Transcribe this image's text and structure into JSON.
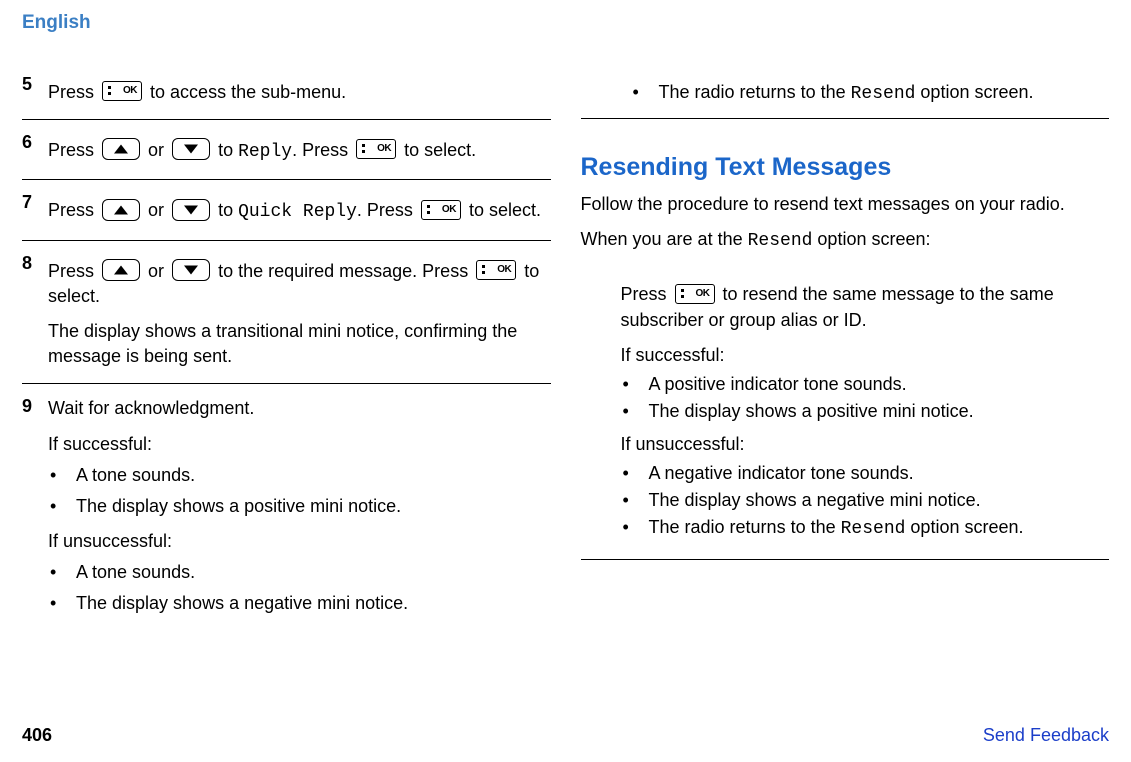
{
  "header": "English",
  "steps": [
    {
      "num": "5",
      "press": "Press ",
      "after": " to access the sub-menu."
    },
    {
      "num": "6",
      "press": "Press ",
      "or": " or ",
      "to": " to ",
      "target": "Reply",
      "period": ". Press ",
      "select": " to select."
    },
    {
      "num": "7",
      "press": "Press ",
      "or": " or ",
      "to": " to ",
      "target": "Quick Reply",
      "period": ". Press ",
      "select": " to select."
    },
    {
      "num": "8",
      "press": "Press ",
      "or": " or ",
      "after1": " to the required message. Press ",
      "select": " to select.",
      "note": "The display shows a transitional mini notice, confirming the message is being sent."
    },
    {
      "num": "9",
      "line1": "Wait for acknowledgment.",
      "success_label": "If successful:",
      "success_items": [
        "A tone sounds.",
        "The display shows a positive mini notice."
      ],
      "fail_label": "If unsuccessful:",
      "fail_items": [
        "A tone sounds.",
        "The display shows a negative mini notice."
      ]
    }
  ],
  "right_top": {
    "pre": "The radio returns to the ",
    "mono": "Resend",
    "post": " option screen."
  },
  "section": {
    "heading": "Resending Text Messages",
    "intro": "Follow the procedure to resend text messages on your radio.",
    "when_pre": "When you are at the ",
    "when_mono": "Resend",
    "when_post": " option screen:",
    "press": "Press ",
    "press_after": " to resend the same message to the same subscriber or group alias or ID.",
    "success_label": "If successful:",
    "success_items": [
      "A positive indicator tone sounds.",
      "The display shows a positive mini notice."
    ],
    "fail_label": "If unsuccessful:",
    "fail_items": [
      "A negative indicator tone sounds.",
      "The display shows a negative mini notice."
    ],
    "fail_extra_pre": "The radio returns to the ",
    "fail_extra_mono": "Resend",
    "fail_extra_post": " option screen."
  },
  "footer": {
    "page": "406",
    "feedback": "Send Feedback"
  },
  "icons": {
    "ok_label": "OK"
  }
}
